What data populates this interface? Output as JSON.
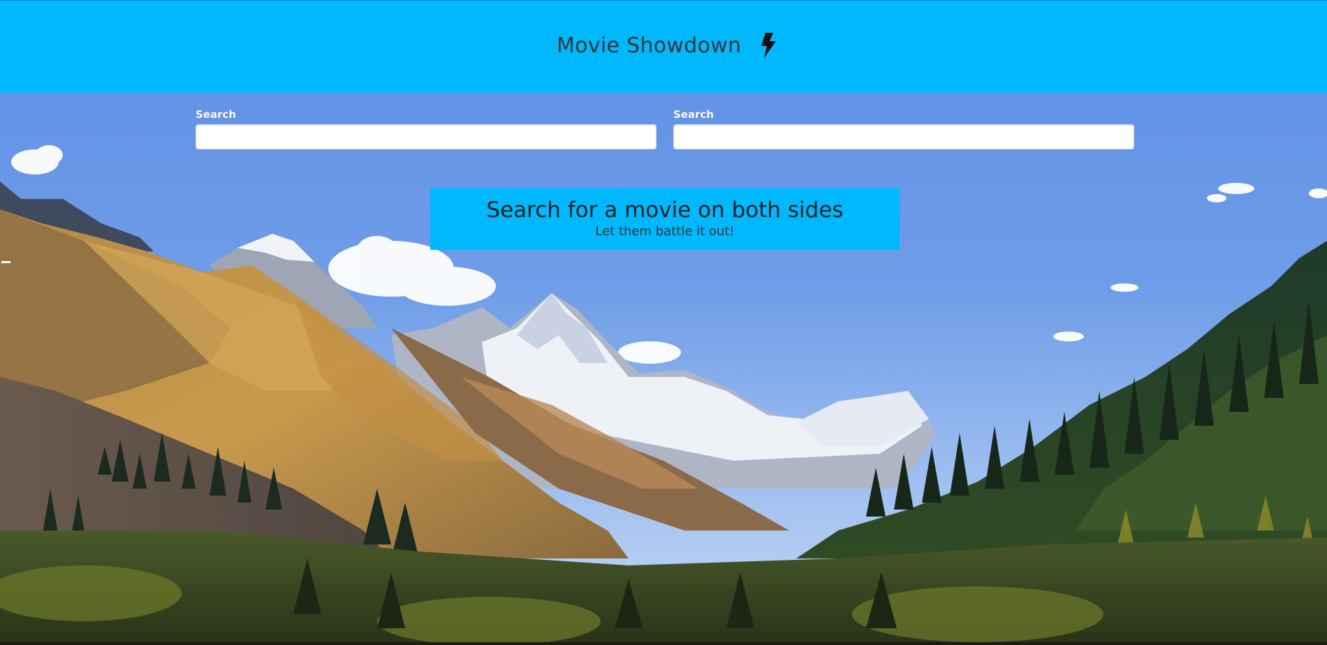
{
  "app": {
    "title": "Movie Showdown",
    "title_icon": "bolt-icon"
  },
  "search": {
    "left": {
      "label": "Search",
      "value": "",
      "placeholder": ""
    },
    "right": {
      "label": "Search",
      "value": "",
      "placeholder": ""
    }
  },
  "cta": {
    "title": "Search for a movie on both sides",
    "subtitle": "Let them battle it out!"
  },
  "colors": {
    "header_bg": "#00b8fe",
    "cta_bg": "#00b8fe",
    "title_text": "#363636",
    "label_text": "#ffffff"
  },
  "background_image": "mountain-valley-landscape"
}
